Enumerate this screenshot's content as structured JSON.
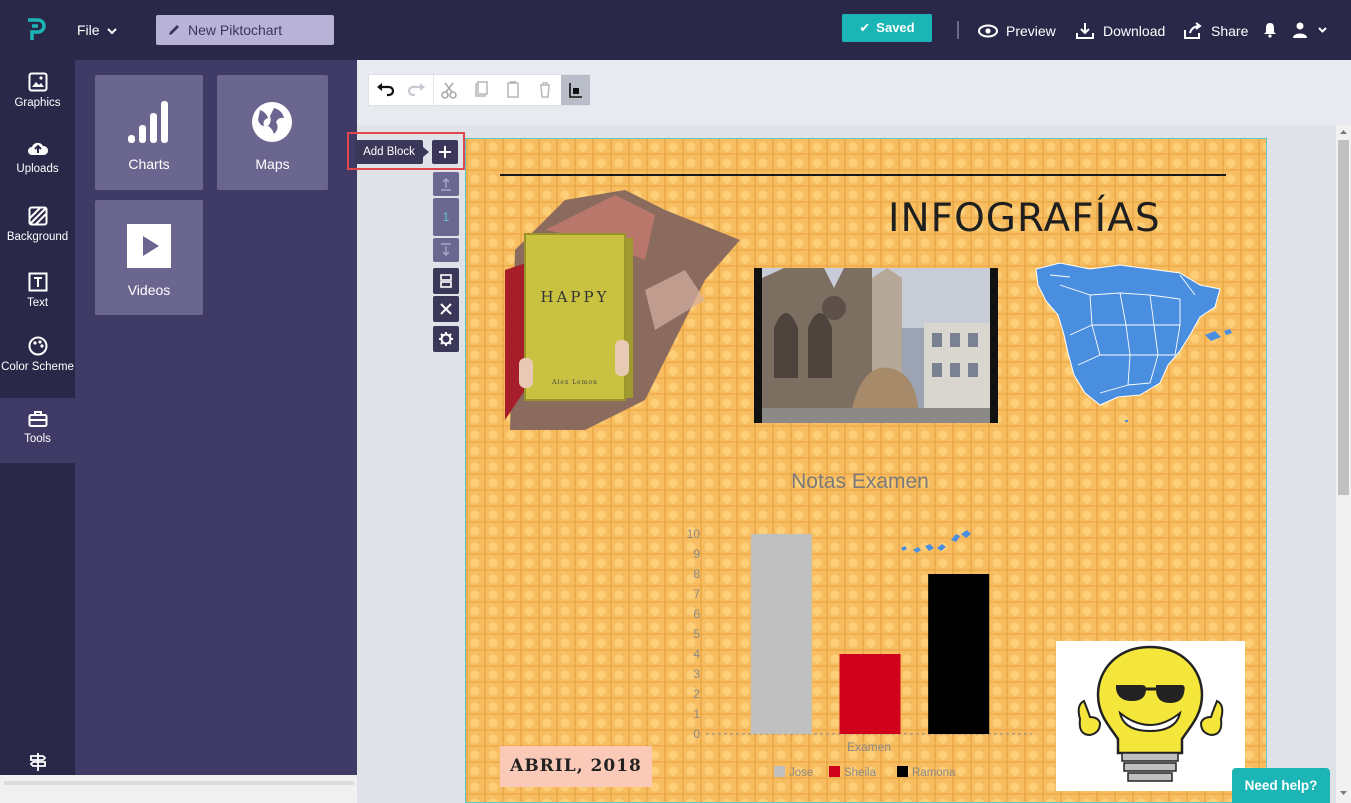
{
  "topbar": {
    "file_label": "File",
    "doc_title": "New Piktochart",
    "saved_label": "Saved",
    "preview_label": "Preview",
    "download_label": "Download",
    "share_label": "Share"
  },
  "rail": [
    {
      "label": "Graphics",
      "icon": "image-icon"
    },
    {
      "label": "Uploads",
      "icon": "cloud-upload-icon"
    },
    {
      "label": "Background",
      "icon": "background-hatch-icon"
    },
    {
      "label": "Text",
      "icon": "text-icon"
    },
    {
      "label": "Color Scheme",
      "icon": "palette-icon"
    },
    {
      "label": "Tools",
      "icon": "toolbox-icon"
    }
  ],
  "tools": [
    {
      "label": "Charts",
      "icon": "bar-chart-icon"
    },
    {
      "label": "Maps",
      "icon": "globe-icon"
    },
    {
      "label": "Videos",
      "icon": "play-icon"
    }
  ],
  "editor": {
    "add_block_label": "Add Block",
    "block_number": "1"
  },
  "canvas": {
    "heading": "INFOGRAFÍAS",
    "book_title": "HAPPY",
    "book_author": "Alex Lemon",
    "date_badge": "ABRIL, 2018"
  },
  "chart_data": {
    "type": "bar",
    "title": "Notas Examen",
    "categories": [
      "Examen"
    ],
    "series": [
      {
        "name": "Jose",
        "values": [
          10
        ],
        "color": "#c0c0c0"
      },
      {
        "name": "Sheila",
        "values": [
          4
        ],
        "color": "#d0021b"
      },
      {
        "name": "Ramona",
        "values": [
          8
        ],
        "color": "#000000"
      }
    ],
    "xlabel": "Examen",
    "ylim": [
      0,
      10
    ],
    "yticks": [
      "0",
      "1",
      "2",
      "3",
      "4",
      "5",
      "6",
      "7",
      "8",
      "9",
      "10"
    ],
    "legend": "bottom"
  },
  "help": {
    "label": "Need help?"
  },
  "colors": {
    "brand": "#2a2848",
    "accent": "#1cb5b5",
    "panel": "#3f3b66"
  }
}
